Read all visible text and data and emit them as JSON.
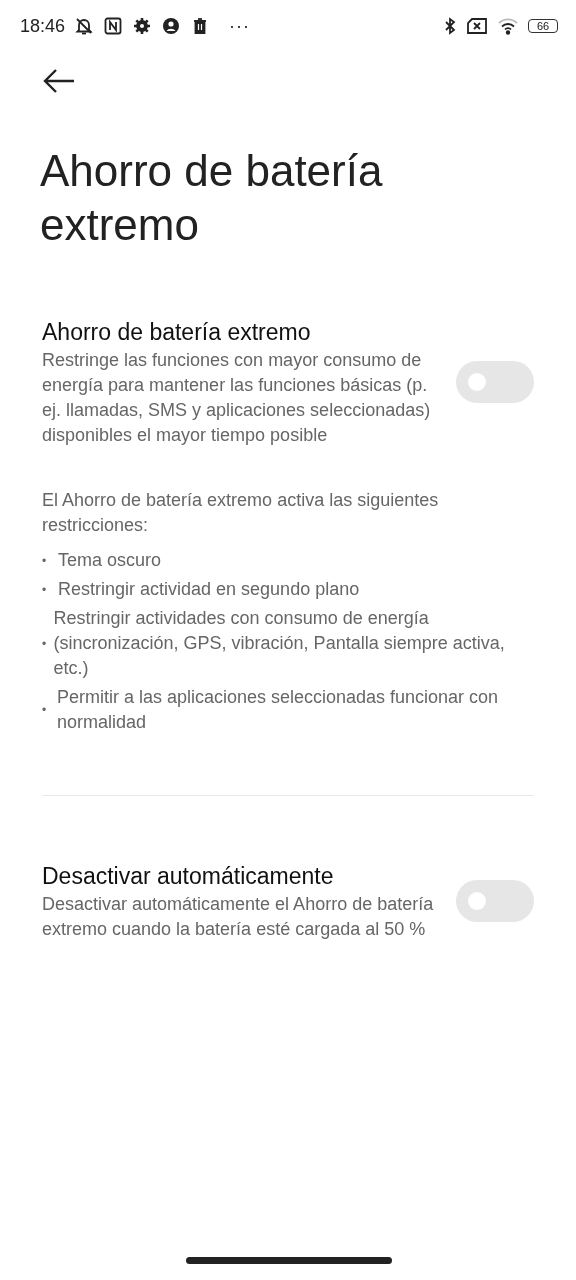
{
  "status_bar": {
    "time": "18:46",
    "more": "···",
    "battery": "66"
  },
  "page": {
    "title": "Ahorro de batería extremo"
  },
  "settings": [
    {
      "title": "Ahorro de batería extremo",
      "description": "Restringe las funciones con mayor consumo de energía para mantener las funciones básicas (p. ej. llamadas, SMS y aplicaciones seleccionadas) disponibles el mayor tiempo posible",
      "on": false,
      "info": {
        "intro": "El Ahorro de batería extremo activa las siguientes restricciones:",
        "items": [
          {
            "bullet": "•",
            "text": "Tema oscuro"
          },
          {
            "bullet": "•",
            "text": "Restringir actividad en segundo plano"
          },
          {
            "bullet": "•",
            "text": "Restringir actividades con consumo de energía (sincronización, GPS, vibración, Pantalla siempre activa, etc.)"
          },
          {
            "bullet": "•",
            "text": "Permitir a las aplicaciones seleccionadas funcionar con normalidad"
          }
        ]
      }
    },
    {
      "title": "Desactivar automáticamente",
      "description": "Desactivar automáticamente el Ahorro de batería extremo cuando la batería esté cargada al 50 %",
      "on": false
    }
  ]
}
